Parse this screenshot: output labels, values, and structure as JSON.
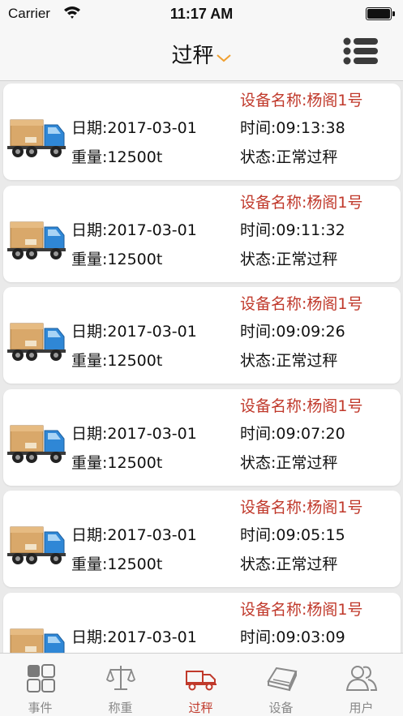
{
  "status_bar": {
    "carrier": "Carrier",
    "time": "11:17 AM"
  },
  "nav": {
    "title": "过秤",
    "chevron_icon": "chevron-down-icon",
    "menu_icon": "list-menu-icon"
  },
  "colors": {
    "accent": "#c0392b",
    "chevron": "#f0a030",
    "tab_inactive": "#888888",
    "background": "#eaeaea"
  },
  "records": [
    {
      "device": "设备名称:杨阁1号",
      "date": "日期:2017-03-01",
      "time": "时间:09:13:38",
      "weight": "重量:12500t",
      "state": "状态:正常过秤"
    },
    {
      "device": "设备名称:杨阁1号",
      "date": "日期:2017-03-01",
      "time": "时间:09:11:32",
      "weight": "重量:12500t",
      "state": "状态:正常过秤"
    },
    {
      "device": "设备名称:杨阁1号",
      "date": "日期:2017-03-01",
      "time": "时间:09:09:26",
      "weight": "重量:12500t",
      "state": "状态:正常过秤"
    },
    {
      "device": "设备名称:杨阁1号",
      "date": "日期:2017-03-01",
      "time": "时间:09:07:20",
      "weight": "重量:12500t",
      "state": "状态:正常过秤"
    },
    {
      "device": "设备名称:杨阁1号",
      "date": "日期:2017-03-01",
      "time": "时间:09:05:15",
      "weight": "重量:12500t",
      "state": "状态:正常过秤"
    },
    {
      "device": "设备名称:杨阁1号",
      "date": "日期:2017-03-01",
      "time": "时间:09:03:09"
    }
  ],
  "tabs": [
    {
      "label": "事件",
      "icon": "grid-icon",
      "active": false
    },
    {
      "label": "称重",
      "icon": "scale-icon",
      "active": false
    },
    {
      "label": "过秤",
      "icon": "truck-icon",
      "active": true
    },
    {
      "label": "设备",
      "icon": "device-icon",
      "active": false
    },
    {
      "label": "用户",
      "icon": "users-icon",
      "active": false
    }
  ]
}
